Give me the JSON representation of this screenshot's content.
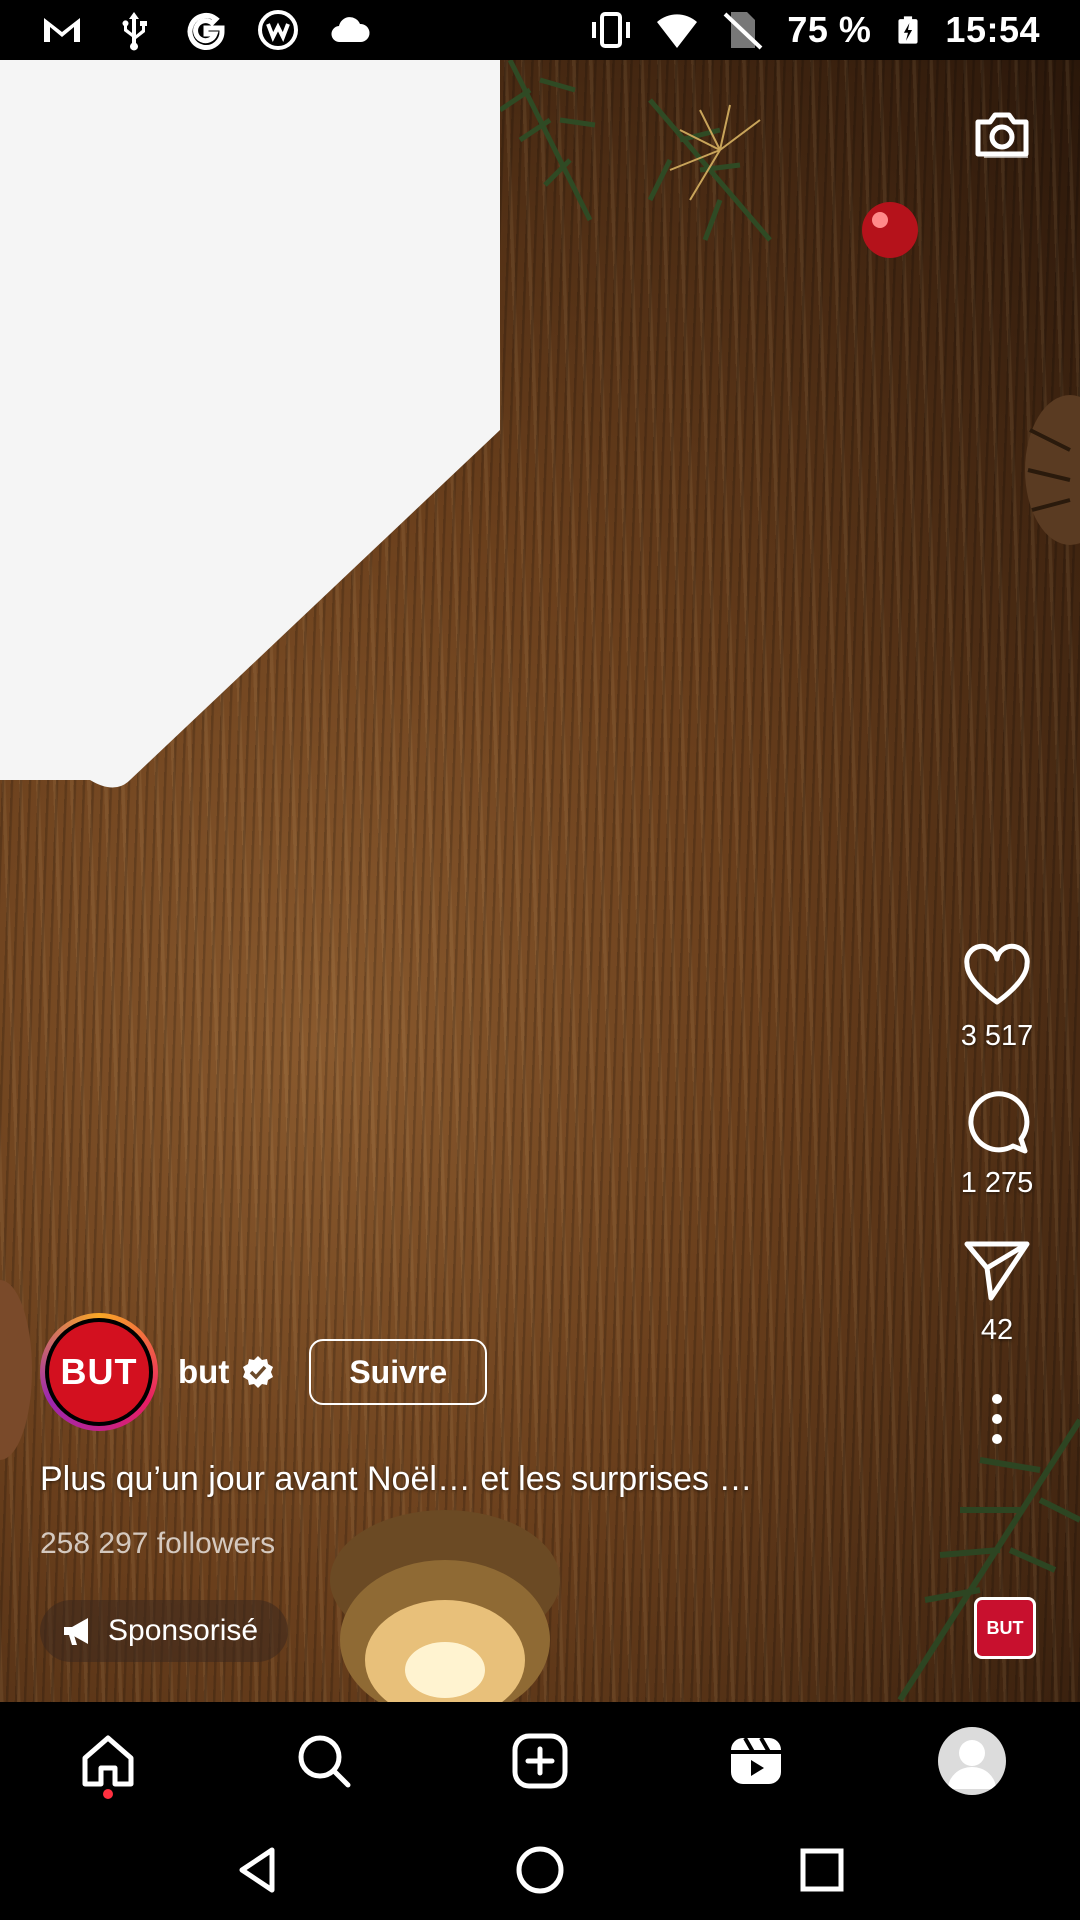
{
  "status_bar": {
    "battery": "75 %",
    "time": "15:54",
    "icons": [
      "gmail-icon",
      "usb-icon",
      "google-icon",
      "app-icon",
      "cloud-icon",
      "vibrate-icon",
      "wifi-icon",
      "no-sim-icon",
      "battery-charging-icon"
    ]
  },
  "reel": {
    "actions": {
      "likes": "3 517",
      "comments": "1 275",
      "shares": "42"
    },
    "author": {
      "avatar_text": "BUT",
      "username": "but",
      "follow_label": "Suivre"
    },
    "caption": "Plus qu’un jour avant Noël… et les surprises …",
    "followers": "258 297 followers",
    "sponsored_label": "Sponsorisé",
    "audio_thumb_text": "BUT"
  },
  "colors": {
    "brand_red": "#d3101f",
    "notification_dot": "#ff3040"
  },
  "bottom_nav": [
    "home-icon",
    "search-icon",
    "create-icon",
    "reels-icon",
    "profile-avatar"
  ],
  "system_nav": [
    "back-icon",
    "home-circle-icon",
    "recents-icon"
  ]
}
